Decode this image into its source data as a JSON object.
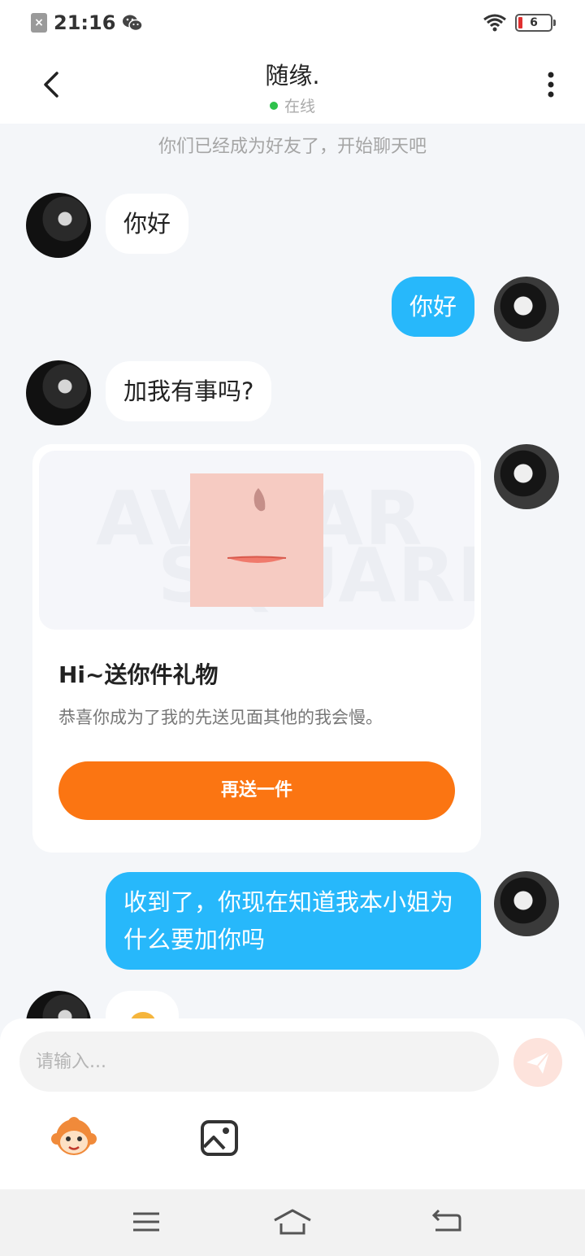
{
  "status_bar": {
    "time": "21:16",
    "battery": "6"
  },
  "header": {
    "title": "随缘.",
    "status": "在线"
  },
  "chat": {
    "system_message": "你们已经成为好友了，开始聊天吧",
    "messages": [
      {
        "from": "them",
        "text": "你好"
      },
      {
        "from": "me",
        "text": "你好"
      },
      {
        "from": "them",
        "text": "加我有事吗?"
      },
      {
        "from": "me",
        "type": "gift"
      },
      {
        "from": "me",
        "text": "收到了，你现在知道我本小姐为什么要加你吗"
      },
      {
        "from": "them",
        "type": "emoji"
      }
    ],
    "gift": {
      "watermark_line1": "AVATAR",
      "watermark_line2": "SQUARE",
      "title": "Hi~送你件礼物",
      "description": "恭喜你成为了我的先送见面其他的我会慢。",
      "button_label": "再送一件"
    }
  },
  "input": {
    "placeholder": "请输入..."
  },
  "icons": {
    "back": "back-arrow-icon",
    "more": "more-vertical-icon",
    "send": "paper-plane-icon",
    "emoji": "monkey-emoji-icon",
    "image": "image-icon",
    "menu": "menu-icon",
    "home": "home-icon",
    "return": "return-icon"
  },
  "colors": {
    "outgoing_bubble": "#27b8fb",
    "gift_button": "#fb7512",
    "online_dot": "#2ec24b"
  }
}
